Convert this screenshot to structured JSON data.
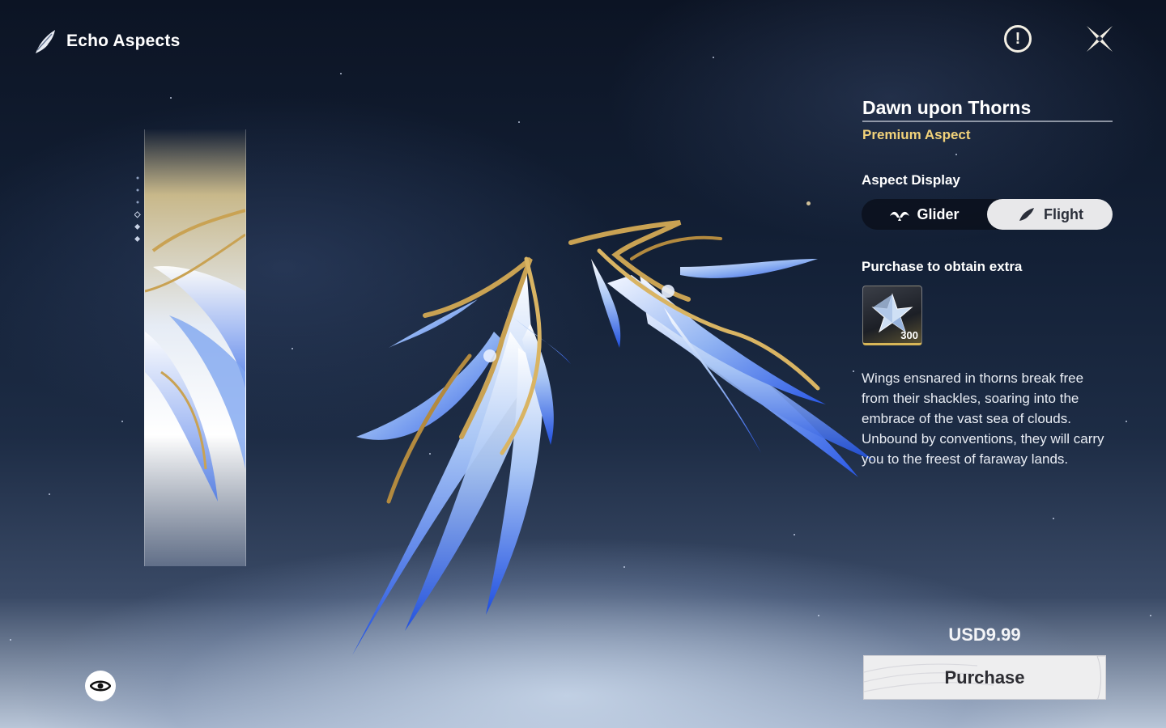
{
  "header": {
    "title": "Echo Aspects",
    "icon": "feather-icon"
  },
  "top_actions": {
    "notice": {
      "glyph": "!",
      "icon": "exclamation-circle-icon"
    },
    "close": {
      "icon": "close-x-icon"
    }
  },
  "aspect": {
    "name": "Dawn upon Thorns",
    "tier": "Premium Aspect",
    "tier_color": "#f2d27a"
  },
  "display": {
    "label": "Aspect Display",
    "options": [
      {
        "label": "Glider",
        "icon": "glider-wings-icon",
        "selected": false
      },
      {
        "label": "Flight",
        "icon": "flight-wing-icon",
        "selected": true
      }
    ]
  },
  "extra": {
    "label": "Purchase to obtain extra",
    "reward": {
      "icon": "crystal-star-icon",
      "quantity": "300"
    }
  },
  "description": "Wings ensnared in thorns break free from their shackles, soaring into the embrace of the vast sea of clouds. Unbound by conventions, they will carry you to the freest of faraway lands.",
  "price": "USD9.99",
  "purchase_label": "Purchase",
  "preview_toggle": {
    "icon": "eye-icon"
  },
  "colors": {
    "accent_gold": "#f2d27a",
    "wing_blue": "#2f5fe0",
    "wing_gold": "#c9a253"
  }
}
